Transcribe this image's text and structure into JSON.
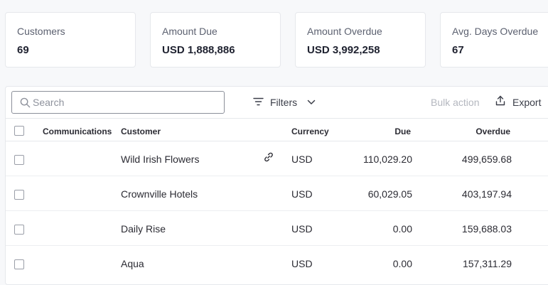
{
  "stats": [
    {
      "label": "Customers",
      "value": "69"
    },
    {
      "label": "Amount Due",
      "value": "USD 1,888,886"
    },
    {
      "label": "Amount Overdue",
      "value": "USD 3,992,258"
    },
    {
      "label": "Avg. Days Overdue",
      "value": "67"
    }
  ],
  "toolbar": {
    "search_placeholder": "Search",
    "filters_label": "Filters",
    "bulk_action_label": "Bulk action",
    "export_label": "Export"
  },
  "table": {
    "columns": [
      "Communications",
      "Customer",
      "Currency",
      "Due",
      "Overdue"
    ],
    "rows": [
      {
        "customer": "Wild Irish Flowers",
        "currency": "USD",
        "due": "110,029.20",
        "overdue": "499,659.68",
        "link": true
      },
      {
        "customer": "Crownville Hotels",
        "currency": "USD",
        "due": "60,029.05",
        "overdue": "403,197.94",
        "link": false
      },
      {
        "customer": "Daily Rise",
        "currency": "USD",
        "due": "0.00",
        "overdue": "159,688.03",
        "link": false
      },
      {
        "customer": "Aqua",
        "currency": "USD",
        "due": "0.00",
        "overdue": "157,311.29",
        "link": false
      }
    ]
  },
  "colors": {
    "muted": "#b4b7bf",
    "border": "#e6e8ec",
    "text": "#2b2b33"
  },
  "icons": [
    "search-icon",
    "filter-icon",
    "chevron-down-icon",
    "export-icon",
    "link-icon"
  ]
}
